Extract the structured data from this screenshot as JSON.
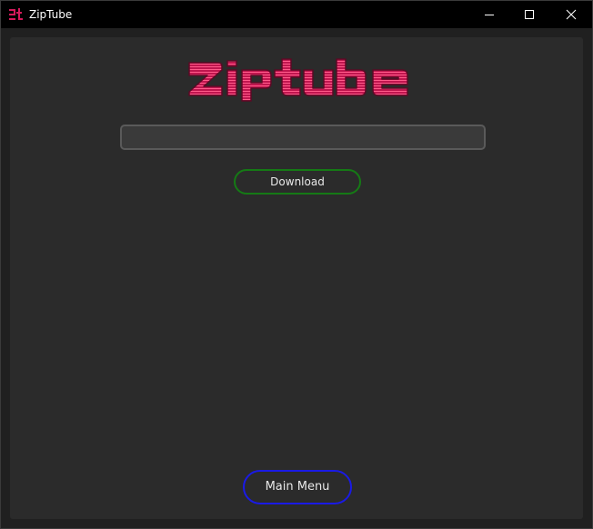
{
  "window": {
    "title": "ZipTube",
    "icon": "ziptube-logo-icon",
    "controls": [
      "minimize-icon",
      "maximize-icon",
      "close-icon"
    ]
  },
  "logo": {
    "text": "ZipTube",
    "color": "#d41a5b"
  },
  "url_field": {
    "value": "",
    "placeholder": ""
  },
  "buttons": {
    "download_label": "Download",
    "main_menu_label": "Main Menu"
  },
  "colors": {
    "logo_accent": "#d41a5b",
    "download_border": "#157a15",
    "main_menu_border": "#1a1ae6",
    "panel_bg": "#2b2b2b",
    "titlebar_bg": "#000000"
  }
}
